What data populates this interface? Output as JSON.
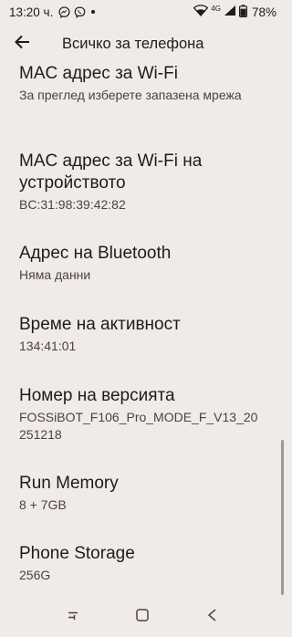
{
  "status_bar": {
    "time": "13:20 ч.",
    "battery_percent": "78%",
    "network": "4G",
    "icons": [
      "messenger-icon",
      "viber-icon",
      "notification-dot-icon",
      "wifi-icon",
      "signal-icon",
      "battery-icon"
    ]
  },
  "app_bar": {
    "back_icon": "arrow-back-icon",
    "title": "Всичко за телефона"
  },
  "items": [
    {
      "title": "MAC адрес за Wi-Fi",
      "summary": "За преглед изберете запазена мрежа"
    },
    {
      "title": "MAC адрес за Wi-Fi на устройството",
      "summary": "BC:31:98:39:42:82"
    },
    {
      "title": "Адрес на Bluetooth",
      "summary": "Няма данни"
    },
    {
      "title": "Време на активност",
      "summary": "134:41:01"
    },
    {
      "title": "Номер на версията",
      "summary": "FOSSiBOT_F106_Pro_MODE_F_V13_20251218"
    },
    {
      "title": "Run Memory",
      "summary": "8 + 7GB"
    },
    {
      "title": "Phone Storage",
      "summary": "256G"
    }
  ],
  "nav_bar": {
    "icons": [
      "recents-icon",
      "home-icon",
      "back-icon"
    ]
  }
}
